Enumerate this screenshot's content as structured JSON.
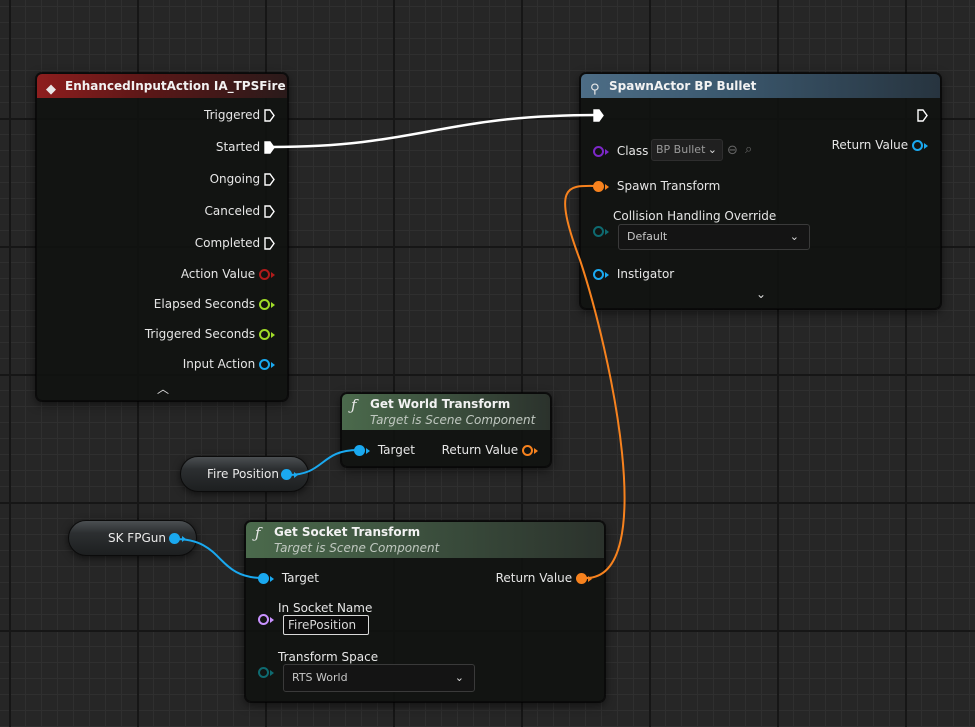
{
  "colors": {
    "exec": "#ffffff",
    "object_blue": "#1aa9f0",
    "transform_orange": "#f7821e",
    "float_green": "#9fdb28",
    "action_red": "#b01b1b",
    "class_purple": "#7d28c8",
    "enum_teal": "#0e6a70",
    "name_violet": "#c992ff"
  },
  "event_node": {
    "icon": "diamond-event-icon",
    "title": "EnhancedInputAction IA_TPSFire",
    "pins": {
      "triggered": "Triggered",
      "started": "Started",
      "ongoing": "Ongoing",
      "canceled": "Canceled",
      "completed": "Completed",
      "action_value": "Action Value",
      "elapsed_seconds": "Elapsed Seconds",
      "triggered_seconds": "Triggered Seconds",
      "input_action": "Input Action"
    },
    "collapse_icon": "chevron-up-icon"
  },
  "spawn_node": {
    "icon": "spawn-actor-icon",
    "title": "SpawnActor BP Bullet",
    "class_label": "Class",
    "class_value": "BP Bullet",
    "return_value": "Return Value",
    "spawn_transform": "Spawn Transform",
    "collision_label": "Collision Handling Override",
    "collision_value": "Default",
    "instigator": "Instigator",
    "expand_icon": "chevron-down-icon"
  },
  "world_transform_node": {
    "icon": "function-icon",
    "title": "Get World Transform",
    "subtitle": "Target is Scene Component",
    "target": "Target",
    "return_value": "Return Value"
  },
  "socket_transform_node": {
    "icon": "function-icon",
    "title": "Get Socket Transform",
    "subtitle": "Target is Scene Component",
    "target": "Target",
    "return_value": "Return Value",
    "socket_name_label": "In Socket Name",
    "socket_name_value": "FirePosition",
    "transform_space_label": "Transform Space",
    "transform_space_value": "RTS World"
  },
  "variables": {
    "fire_position": "Fire Position",
    "sk_fpgun": "SK FPGun"
  }
}
